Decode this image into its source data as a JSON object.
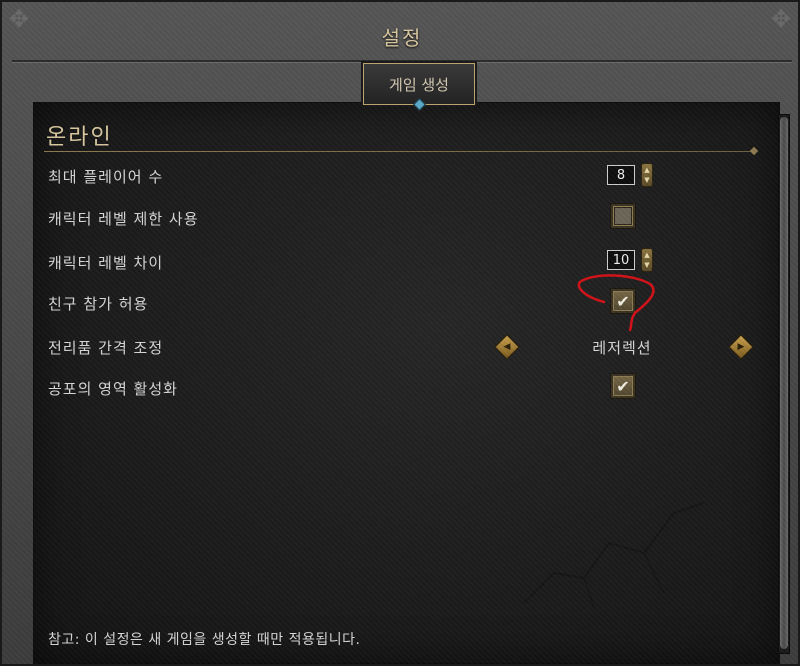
{
  "window": {
    "title": "설정"
  },
  "tabs": [
    {
      "label": "게임 생성",
      "active": true
    }
  ],
  "section": {
    "title": "온라인"
  },
  "settings": {
    "max_players": {
      "label": "최대 플레이어 수",
      "value": "8"
    },
    "level_limit": {
      "label": "캐릭터 레벨 제한 사용",
      "checked": false
    },
    "level_diff": {
      "label": "캐릭터 레벨 차이",
      "value": "10"
    },
    "allow_friends": {
      "label": "친구 참가 허용",
      "checked": true
    },
    "loot_spacing": {
      "label": "전리품 간격 조정",
      "value": "레저렉션"
    },
    "terror_zones": {
      "label": "공포의 영역 활성화",
      "checked": true
    }
  },
  "note": "참고: 이 설정은 새 게임을 생성할 때만 적용됩니다.",
  "icons": {
    "checkmark": "check-icon",
    "stepper_up": "caret-up-icon",
    "stepper_down": "caret-down-icon",
    "prev": "arrow-left-icon",
    "next": "arrow-right-icon"
  },
  "colors": {
    "accent_gold": "#bba46d",
    "title_text": "#d8c7a0",
    "annotation_red": "#d0141a"
  }
}
